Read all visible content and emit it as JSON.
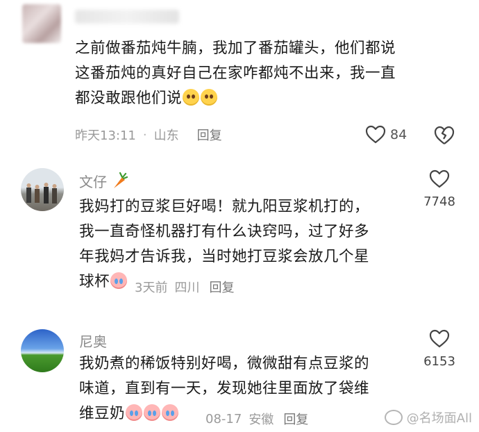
{
  "comments": [
    {
      "user": "",
      "text_lines": [
        "之前做番茄炖牛腩，我加了番茄罐头，他们都说",
        "这番茄炖的真好自己在家咋都炖不出来，我一直",
        "都没敢跟他们说"
      ],
      "time": "昨天13:11",
      "location": "山东",
      "reply_label": "回复",
      "likes": "84"
    },
    {
      "user": "文仔",
      "text_lines": [
        "我妈打的豆浆巨好喝！就九阳豆浆机打的，",
        "我一直奇怪机器打有什么诀窍吗，过了好多",
        "年我妈才告诉我，当时她打豆浆会放几个星",
        "球杯"
      ],
      "time": "3天前",
      "location": "四川",
      "reply_label": "回复",
      "likes": "7748"
    },
    {
      "user": "尼奥",
      "text_lines": [
        "我奶煮的稀饭特别好喝，微微甜有点豆浆的",
        "味道，直到有一天，发现她往里面放了袋维",
        "维豆奶"
      ],
      "time": "08-17",
      "location": "安徽",
      "reply_label": "回复",
      "likes": "6153"
    }
  ],
  "watermark": "@名场面All",
  "colors": {
    "meta_text": "#9a9a9a",
    "body_text": "#1a1a1a",
    "carrot": "#f07b1d"
  }
}
